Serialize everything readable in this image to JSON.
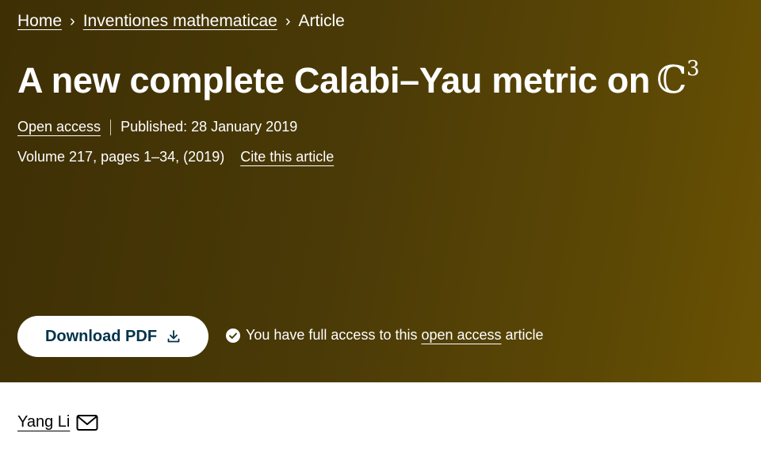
{
  "breadcrumb": {
    "items": [
      "Home",
      "Inventiones mathematicae",
      "Article"
    ],
    "separator": "›"
  },
  "article": {
    "title_text": "A new complete Calabi–Yau metric on",
    "title_symbol": "ℂ",
    "title_exponent": "3",
    "open_access_label": "Open access",
    "published": "Published: 28 January 2019",
    "volume_info": "Volume 217, pages 1–34, (2019)",
    "cite_label": "Cite this article"
  },
  "actions": {
    "download_label": "Download PDF",
    "access_prefix": "You have full access to this",
    "access_link": "open access",
    "access_suffix": "article"
  },
  "authors": [
    {
      "name": "Yang Li",
      "icon": "envelope-icon"
    }
  ],
  "colors": {
    "hero_start": "#3e2f05",
    "hero_end": "#6a5204",
    "button_text": "#01324b"
  }
}
